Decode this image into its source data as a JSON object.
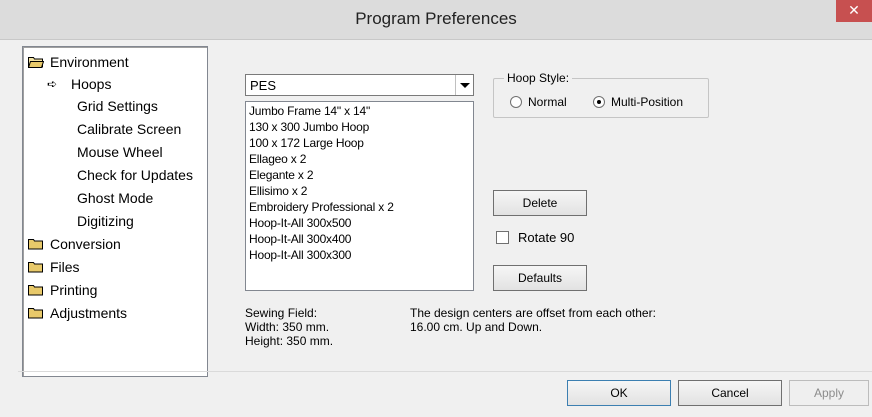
{
  "window": {
    "title": "Program Preferences",
    "close_glyph": "✕"
  },
  "tree": {
    "items": [
      {
        "label": "Environment",
        "type": "folder"
      },
      {
        "label": "Hoops",
        "type": "child-selected"
      },
      {
        "label": "Grid Settings",
        "type": "child"
      },
      {
        "label": "Calibrate Screen",
        "type": "child"
      },
      {
        "label": "Mouse Wheel",
        "type": "child"
      },
      {
        "label": "Check for Updates",
        "type": "child"
      },
      {
        "label": "Ghost Mode",
        "type": "child"
      },
      {
        "label": "Digitizing",
        "type": "child"
      },
      {
        "label": "Conversion",
        "type": "folder"
      },
      {
        "label": "Files",
        "type": "folder"
      },
      {
        "label": "Printing",
        "type": "folder"
      },
      {
        "label": "Adjustments",
        "type": "folder"
      }
    ],
    "selected_arrow": "➪"
  },
  "format_select": {
    "value": "PES"
  },
  "hoop_list": [
    "Jumbo Frame 14\" x 14\"",
    "130 x 300 Jumbo Hoop",
    "100 x 172 Large Hoop",
    "Ellageo x 2",
    "Elegante x 2",
    "Ellisimo x 2",
    "Embroidery Professional x 2",
    "Hoop-It-All 300x500",
    "Hoop-It-All 300x400",
    "Hoop-It-All 300x300"
  ],
  "hoop_style": {
    "legend": "Hoop Style:",
    "options": [
      {
        "label": "Normal",
        "selected": false
      },
      {
        "label": "Multi-Position",
        "selected": true
      }
    ]
  },
  "buttons": {
    "delete": "Delete",
    "defaults": "Defaults",
    "ok": "OK",
    "cancel": "Cancel",
    "apply": "Apply"
  },
  "rotate": {
    "label": "Rotate 90",
    "checked": false
  },
  "sewing_field": {
    "heading": "Sewing Field:",
    "width": "Width: 350 mm.",
    "height": "Height: 350 mm."
  },
  "offset_info": {
    "line1": "The design centers are offset from each other:",
    "line2": "16.00 cm. Up and Down."
  },
  "colors": {
    "titlebar": "#dcdcdc",
    "close": "#c75050",
    "folder": "#e8c96a"
  }
}
